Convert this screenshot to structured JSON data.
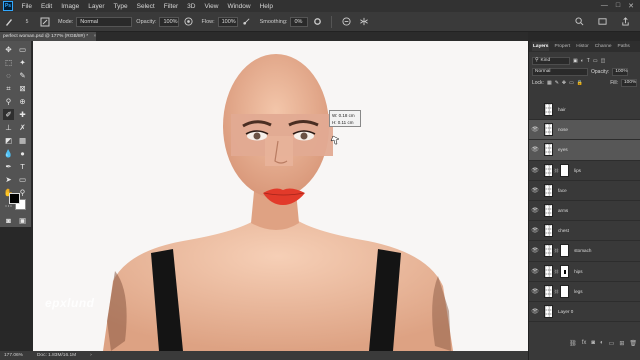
{
  "app": {
    "logo": "Ps"
  },
  "menu": [
    "File",
    "Edit",
    "Image",
    "Layer",
    "Type",
    "Select",
    "Filter",
    "3D",
    "View",
    "Window",
    "Help"
  ],
  "window_controls": [
    "—",
    "□",
    "✕"
  ],
  "options": {
    "mode_label": "Mode:",
    "mode_value": "Normal",
    "opacity_label": "Opacity:",
    "opacity_value": "100%",
    "flow_label": "Flow:",
    "flow_value": "100%",
    "smoothing_label": "Smoothing:",
    "smoothing_value": "0%",
    "brush_size": "5"
  },
  "document": {
    "tab_title": "perfect woman.psd @ 177% (RGB/8#) *",
    "close": "×"
  },
  "measure": {
    "width": "0.18 cm",
    "height": "0.11 cm"
  },
  "watermark": "epxlund",
  "status": {
    "zoom": "177.06%",
    "doc": "Doc: 1.83M/16.1M"
  },
  "panel": {
    "tabs": [
      "Layers",
      "Propert",
      "Histor",
      "Channe",
      "Paths"
    ],
    "kind_label": "Kind",
    "blend_mode": "Normal",
    "opacity_label": "Opacity:",
    "opacity_value": "100%",
    "lock_label": "Lock:",
    "fill_label": "Fill:",
    "fill_value": "100%"
  },
  "layers": [
    {
      "name": "hair",
      "visible": false,
      "mask": false,
      "selected": false
    },
    {
      "name": "nose",
      "visible": true,
      "mask": false,
      "selected": true
    },
    {
      "name": "eyes",
      "visible": true,
      "mask": false,
      "selected": true
    },
    {
      "name": "lips",
      "visible": true,
      "mask": true,
      "selected": false
    },
    {
      "name": "face",
      "visible": true,
      "mask": false,
      "selected": false
    },
    {
      "name": "arms",
      "visible": true,
      "mask": false,
      "selected": false
    },
    {
      "name": "chest",
      "visible": true,
      "mask": false,
      "selected": false
    },
    {
      "name": "stomach",
      "visible": true,
      "mask": true,
      "selected": false
    },
    {
      "name": "hips",
      "visible": true,
      "mask": true,
      "selected": false
    },
    {
      "name": "legs",
      "visible": true,
      "mask": true,
      "selected": false
    },
    {
      "name": "Layer 0",
      "visible": true,
      "mask": false,
      "selected": false
    }
  ],
  "colors": {
    "accent": "#31a8ff",
    "panel": "#393939",
    "toolbar": "#535353",
    "canvas": "#f8f6f5"
  }
}
